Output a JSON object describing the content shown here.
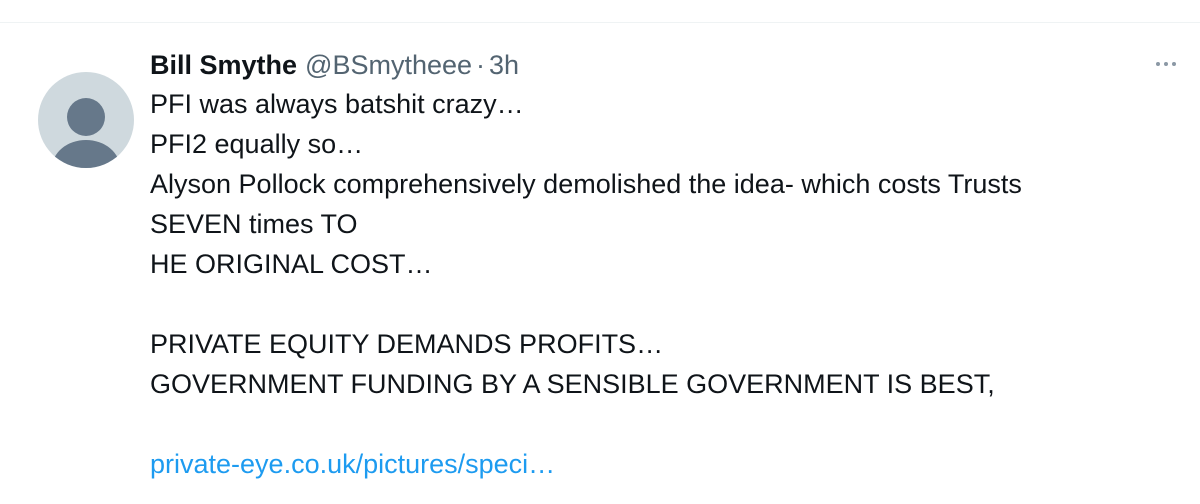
{
  "tweet": {
    "author_name": "Bill Smythe",
    "handle": "@BSmytheee",
    "separator": "·",
    "time": "3h",
    "lines": [
      "PFI was always batshit crazy…",
      "PFI2 equally so…",
      "Alyson Pollock comprehensively demolished the idea- which costs Trusts",
      "SEVEN times TO",
      "HE ORIGINAL COST…",
      "",
      "PRIVATE EQUITY DEMANDS PROFITS…",
      "GOVERNMENT FUNDING BY A SENSIBLE GOVERNMENT IS BEST,",
      ""
    ],
    "link_text": "private-eye.co.uk/pictures/speci…"
  },
  "icons": {
    "avatar": "default-avatar-icon",
    "more": "more-options-icon"
  },
  "colors": {
    "link": "#1d9bf0",
    "secondary_text": "#536471",
    "avatar_bg": "#cfd9de",
    "avatar_fg": "#66788a"
  }
}
